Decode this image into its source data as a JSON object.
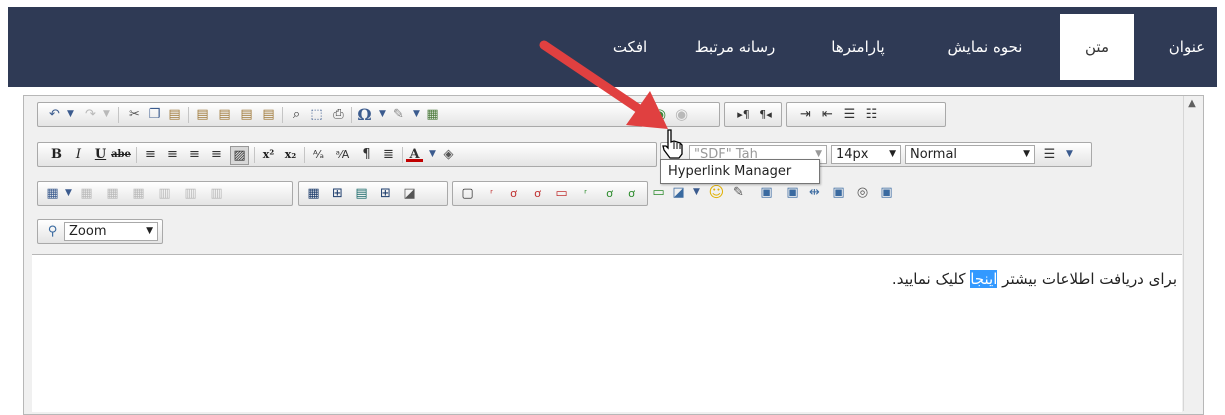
{
  "tabs": [
    {
      "label": "عنوان",
      "active": false
    },
    {
      "label": "متن",
      "active": true
    },
    {
      "label": "نحوه نمایش",
      "active": false
    },
    {
      "label": "پارامترها",
      "active": false
    },
    {
      "label": "رسانه مرتبط",
      "active": false
    },
    {
      "label": "افکت",
      "active": false
    }
  ],
  "toolbar": {
    "bold": "B",
    "italic": "I",
    "underline": "U",
    "strike": "abe",
    "omega": "Ω",
    "font_color": "A",
    "font_name": "\"SDF\" Tah",
    "font_size": "14px",
    "paragraph": "Normal",
    "zoom": "Zoom"
  },
  "tooltip": "Hyperlink Manager",
  "content": {
    "before": "برای دریافت اطلاعات بیشتر ",
    "highlight": "اینجا",
    "after": " کلیک نمایید."
  },
  "colors": {
    "topbar": "#2f3a55",
    "highlight": "#3399ff",
    "arrow": "#e04040"
  }
}
